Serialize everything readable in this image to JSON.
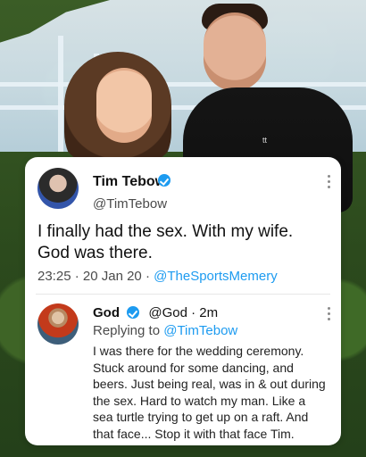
{
  "tweet": {
    "author": {
      "name": "Tim Tebow",
      "handle": "@TimTebow"
    },
    "text_line1": "I finally had the sex. With my wife.",
    "text_line2": "God was there.",
    "meta": {
      "time": "23:25",
      "date": "20 Jan 20",
      "source": "@TheSportsMemery"
    },
    "icons": {
      "verified": "verified-badge-icon",
      "more": "more-vertical-icon"
    }
  },
  "reply": {
    "author": {
      "name": "God",
      "handle": "@God",
      "age": "2m"
    },
    "replying_prefix": "Replying to",
    "replying_to": "@TimTebow",
    "text_lines": [
      "I was there for the wedding ceremony.",
      "Stuck around for some dancing, and",
      "beers. Just being real, was in & out during",
      "the sex. Hard to watch my man. Like a",
      "sea turtle trying to get up on a raft. And",
      "that face... Stop it with that face Tim."
    ],
    "icons": {
      "verified": "verified-badge-icon",
      "more": "more-vertical-icon"
    }
  },
  "colors": {
    "link": "#1d9bf0",
    "text": "#111111",
    "muted": "#4b4b4b",
    "card": "#ffffff"
  },
  "photo": {
    "lapel_pin_text": "tt"
  }
}
